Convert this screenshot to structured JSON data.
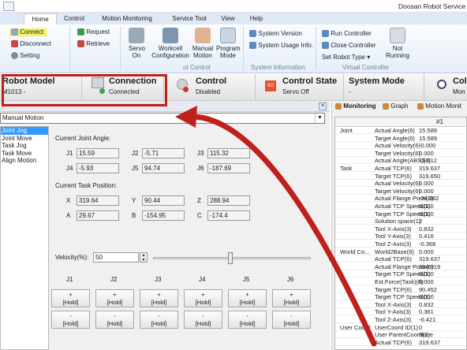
{
  "window": {
    "title": "Doosan Robot Service T"
  },
  "tabs": [
    "Home",
    "Control",
    "Motion Monitoring",
    "Service Tool",
    "View",
    "Help"
  ],
  "ribbon": {
    "connect": "Connect",
    "disconnect": "Disconnect",
    "setting": "Setting",
    "request": "Request",
    "retrieve": "Retrieve",
    "servo_on": "Servo On",
    "workcell": "Workcell Configuration",
    "manual_motion": "Manual Motion",
    "program_mode": "Program Mode",
    "robot_control_group": "ot Control",
    "system_version": "System Version",
    "system_usage": "System Usage Info.",
    "system_info_group": "System Information",
    "run_controller": "Run Controller",
    "close_controller": "Close Controller",
    "set_robot_type": "Set Robot Type",
    "not_running": "Not Running",
    "virtual_controller_group": "Virtual Controller"
  },
  "status": {
    "robot_model_title": "Robot Model",
    "robot_model_value": "M1013 -",
    "connection_title": "Connection",
    "connection_value": "Connected",
    "control_title": "Control",
    "control_value": "Disabled",
    "control_state_title": "Control State",
    "control_state_value": "Servo Off",
    "system_mode_title": "System Mode",
    "system_mode_value": "-",
    "col_title": "Col",
    "col_value": "Mon"
  },
  "motion_mode": "Manual Motion",
  "motion_list": [
    "Joint Jog",
    "Joint Move",
    "Task Jog",
    "Task Move",
    "Align Motion"
  ],
  "joint_panel": {
    "joint_angle_label": "Current Joint Angle:",
    "task_pos_label": "Current Task Position:",
    "joints": [
      {
        "label": "J1",
        "value": "15.59"
      },
      {
        "label": "J2",
        "value": "-5.71"
      },
      {
        "label": "J3",
        "value": "115.32"
      },
      {
        "label": "J4",
        "value": "-5.93"
      },
      {
        "label": "J5",
        "value": "94.74"
      },
      {
        "label": "J6",
        "value": "-187.69"
      }
    ],
    "task": [
      {
        "label": "X",
        "value": "319.64"
      },
      {
        "label": "Y",
        "value": "90.44"
      },
      {
        "label": "Z",
        "value": "288.94"
      },
      {
        "label": "A",
        "value": "29.67"
      },
      {
        "label": "B",
        "value": "-154.95"
      },
      {
        "label": "C",
        "value": "-174.4"
      }
    ],
    "velocity_label": "Velocity(%):",
    "velocity_value": "50",
    "velocity_fraction": 0.5,
    "jog_headers": [
      "J1",
      "J2",
      "J3",
      "J4",
      "J5",
      "J6"
    ],
    "plus_label": "+",
    "minus_label": "-",
    "hold_label": "[Hold]"
  },
  "right_tabs": [
    "Monitoring",
    "Graph",
    "Motion Monit"
  ],
  "grid": {
    "column_header": "#1",
    "rows": [
      {
        "cat": "Joint",
        "name": "Actual Angle(6)",
        "val": "15.589"
      },
      {
        "cat": "",
        "name": "Target Angle(6)",
        "val": "15.589"
      },
      {
        "cat": "",
        "name": "Actual Velocity(6)",
        "val": "-0.000"
      },
      {
        "cat": "",
        "name": "Target Velocity(6)",
        "val": "0.000"
      },
      {
        "cat": "",
        "name": "Actual Angle(ABS)(6)",
        "val": "15.612"
      },
      {
        "cat": "Task",
        "name": "Actual TCP(6)",
        "val": "319.637"
      },
      {
        "cat": "",
        "name": "Target TCP(6)",
        "val": "319.650"
      },
      {
        "cat": "",
        "name": "Actual Velocity(6)",
        "val": "0.000"
      },
      {
        "cat": "",
        "name": "Target Velocity(6)",
        "val": "0.000"
      },
      {
        "cat": "",
        "name": "Actual Flange Pose(6)",
        "val": "-74.382"
      },
      {
        "cat": "",
        "name": "Actual TCP Speed(1)",
        "val": "0.000"
      },
      {
        "cat": "",
        "name": "Target TCP Speed(1)",
        "val": "0.000"
      },
      {
        "cat": "",
        "name": "Solution space(1)",
        "val": "2"
      },
      {
        "cat": "",
        "name": "Tool X-Axis(3)",
        "val": "0.832"
      },
      {
        "cat": "",
        "name": "Tool Y-Axis(3)",
        "val": "0.416"
      },
      {
        "cat": "",
        "name": "Tool Z-Axis(3)",
        "val": "-0.368"
      },
      {
        "cat": "World Co...",
        "name": "World2Base(6)",
        "val": "0.000"
      },
      {
        "cat": "",
        "name": "Actual TCP(6)",
        "val": "319.637"
      },
      {
        "cat": "",
        "name": "Actual Flange Pose(6)",
        "val": "394.019"
      },
      {
        "cat": "",
        "name": "Target TCP Speed(1)",
        "val": "0.000"
      },
      {
        "cat": "",
        "name": "Ext.Force(Task)(6)",
        "val": "0.000"
      },
      {
        "cat": "",
        "name": "Target TCP(6)",
        "val": "90.452"
      },
      {
        "cat": "",
        "name": "Target TCP Speed(1)",
        "val": "0.000"
      },
      {
        "cat": "",
        "name": "Tool X-Axis(3)",
        "val": "0.832"
      },
      {
        "cat": "",
        "name": "Tool Y-Axis(3)",
        "val": "0.361"
      },
      {
        "cat": "",
        "name": "Tool Z-Axis(3)",
        "val": "-0.421"
      },
      {
        "cat": "User Coord",
        "name": "UserCoord ID(1)",
        "val": "0"
      },
      {
        "cat": "",
        "name": "User ParentCoord(1)",
        "val": "None"
      },
      {
        "cat": "",
        "name": "Actual TCP(6)",
        "val": "319.637"
      }
    ]
  },
  "colors": {
    "highlight": "#c0201c",
    "connect_highlight": "#f2f25a",
    "selection": "#3399ff"
  }
}
